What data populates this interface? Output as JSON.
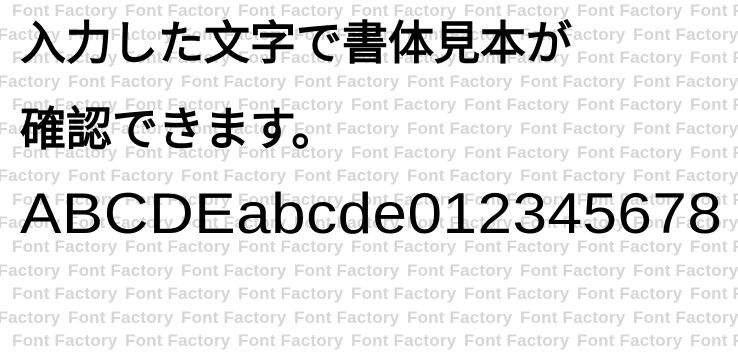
{
  "watermark": "Font Factory",
  "sample": {
    "line1": "入力した文字で書体見本が",
    "line2": "確認できます。",
    "line3": "ABCDEabcde012345678"
  }
}
